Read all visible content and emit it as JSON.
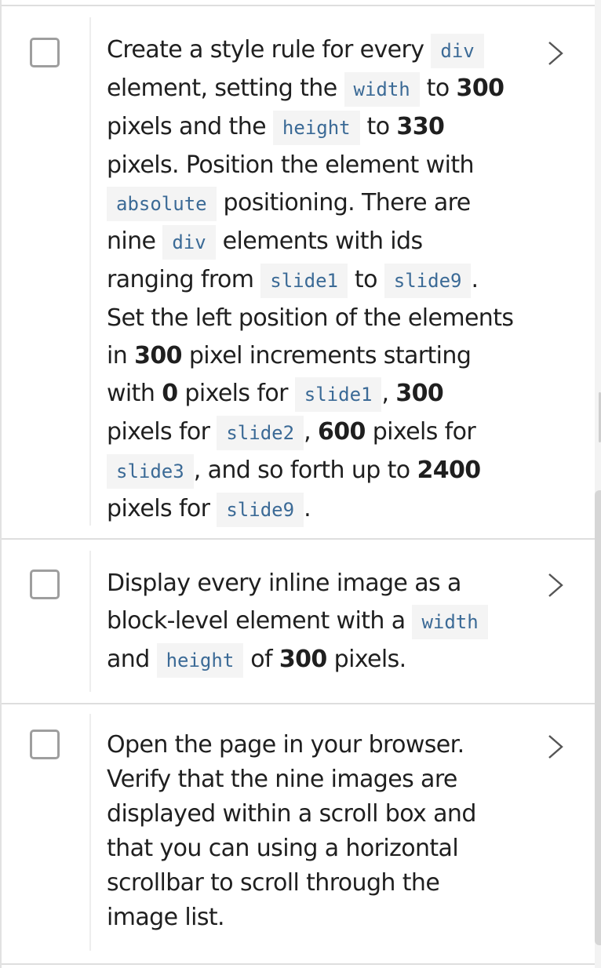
{
  "steps": [
    {
      "checked": false,
      "segments": [
        {
          "t": "Create a style rule for every "
        },
        {
          "code": "div"
        },
        {
          "t": " element, setting the "
        },
        {
          "code": "width"
        },
        {
          "t": " to "
        },
        {
          "b": "300"
        },
        {
          "t": " pixels and the "
        },
        {
          "code": "height"
        },
        {
          "t": " to "
        },
        {
          "b": "330"
        },
        {
          "t": " pixels. Position the element with "
        },
        {
          "code": "absolute"
        },
        {
          "t": " positioning. There are nine "
        },
        {
          "code": "div"
        },
        {
          "t": " elements with ids ranging from "
        },
        {
          "code": "slide1"
        },
        {
          "t": " to "
        },
        {
          "code": "slide9"
        },
        {
          "t": ". Set the left position of the elements in "
        },
        {
          "b": "300"
        },
        {
          "t": " pixel increments starting with "
        },
        {
          "b": "0"
        },
        {
          "t": " pixels for "
        },
        {
          "code": "slide1"
        },
        {
          "t": ", "
        },
        {
          "b": "300"
        },
        {
          "t": " pixels for "
        },
        {
          "code": "slide2"
        },
        {
          "t": ", "
        },
        {
          "b": "600"
        },
        {
          "t": " pixels for "
        },
        {
          "code": "slide3"
        },
        {
          "t": ", and so forth up to "
        },
        {
          "b": "2400"
        },
        {
          "t": " pixels for "
        },
        {
          "code": "slide9"
        },
        {
          "t": "."
        }
      ]
    },
    {
      "checked": false,
      "segments": [
        {
          "t": "Display every inline image as a block-level element with a "
        },
        {
          "code": "width"
        },
        {
          "t": " and "
        },
        {
          "code": "height"
        },
        {
          "t": " of "
        },
        {
          "b": "300"
        },
        {
          "t": " pixels."
        }
      ]
    },
    {
      "checked": false,
      "segments": [
        {
          "t": "Open the page in your browser. Verify that the nine images are displayed within a scroll box and that you can using a horizontal scrollbar to scroll through the image list."
        }
      ]
    }
  ],
  "icons": {
    "checkbox": "checkbox-unchecked-icon",
    "expand": "chevron-right-icon"
  },
  "colors": {
    "code_text": "#3b6a96",
    "code_bg": "#f4f4f4",
    "checkbox_border": "#9e9e9e",
    "divider": "#dedede"
  }
}
